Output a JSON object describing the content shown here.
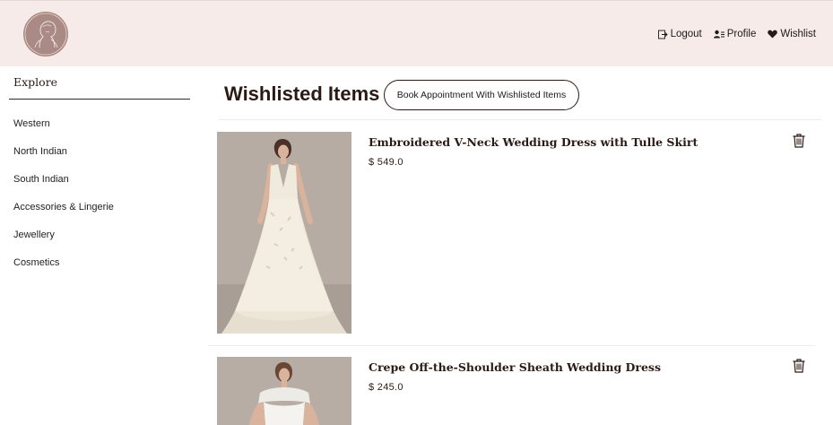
{
  "header": {
    "logo_icon": "woman-profile-logo-icon",
    "nav": [
      {
        "label": "Logout",
        "icon": "logout-icon"
      },
      {
        "label": "Profile",
        "icon": "profile-icon"
      },
      {
        "label": "Wishlist",
        "icon": "heart-icon"
      }
    ]
  },
  "sidebar": {
    "title": "Explore",
    "items": [
      {
        "label": "Western"
      },
      {
        "label": "North Indian"
      },
      {
        "label": "South Indian"
      },
      {
        "label": "Accessories & Lingerie"
      },
      {
        "label": "Jewellery"
      },
      {
        "label": "Cosmetics"
      }
    ]
  },
  "main": {
    "title": "Wishlisted Items",
    "book_button_label": "Book Appointment With Wishlisted Items",
    "items": [
      {
        "name": "Embroidered V-Neck Wedding Dress with Tulle Skirt",
        "price": "$ 549.0",
        "delete_icon": "trash-icon"
      },
      {
        "name": "Crepe Off-the-Shoulder Sheath Wedding Dress",
        "price": "$ 245.0",
        "delete_icon": "trash-icon"
      }
    ]
  },
  "colors": {
    "header_bg": "#f6ebe8",
    "logo_bg": "#a98a84",
    "text_dark": "#2b1a14"
  }
}
